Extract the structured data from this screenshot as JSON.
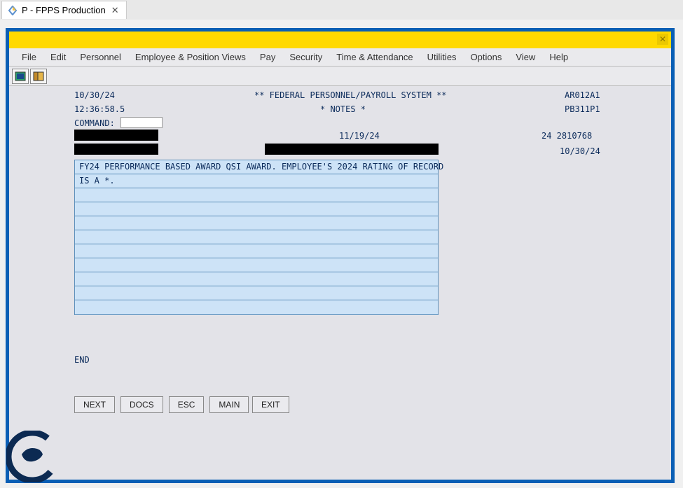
{
  "tab": {
    "title": "P - FPPS Production"
  },
  "menu": [
    "File",
    "Edit",
    "Personnel",
    "Employee & Position Views",
    "Pay",
    "Security",
    "Time & Attendance",
    "Utilities",
    "Options",
    "View",
    "Help"
  ],
  "header": {
    "date": "10/30/24",
    "system_title": "** FEDERAL PERSONNEL/PAYROLL SYSTEM **",
    "screen_id": "AR012A1",
    "time": "12:36:58.5",
    "section": "* NOTES *",
    "panel_id": "PB311P1",
    "command_label": "COMMAND:",
    "eff_date": "11/19/24",
    "batch": "24 2810768",
    "run_date": "10/30/24"
  },
  "notes": [
    "FY24 PERFORMANCE BASED AWARD QSI AWARD. EMPLOYEE'S 2024 RATING OF RECORD",
    "IS A *.",
    "",
    "",
    "",
    "",
    "",
    "",
    "",
    "",
    ""
  ],
  "footer_text": "END",
  "buttons": {
    "next": "NEXT",
    "docs": "DOCS",
    "esc": "ESC",
    "main": "MAIN",
    "exit": "EXIT"
  }
}
